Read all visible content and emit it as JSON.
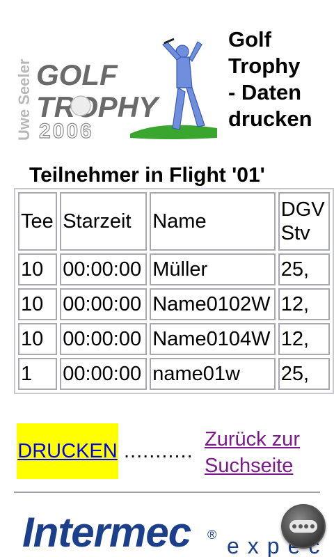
{
  "logo": {
    "author": "Uwe Seeler",
    "word1": "GOLF",
    "word2": "TROPHY",
    "year": "2006"
  },
  "page_title_lines": [
    "Golf",
    "Trophy",
    "- Daten",
    "drucken"
  ],
  "flight_heading": "Teilnehmer in Flight '01'",
  "table": {
    "headers": [
      "Tee",
      "Starzeit",
      "Name",
      "DGV",
      "Stv"
    ],
    "rows": [
      [
        "10",
        "00:00:00",
        "Müller",
        "25,"
      ],
      [
        "10",
        "00:00:00",
        "Name0102W",
        "12,"
      ],
      [
        "10",
        "00:00:00",
        "Name0104W",
        "12,"
      ],
      [
        "1",
        "00:00:00",
        "name01w",
        "25,"
      ]
    ]
  },
  "actions": {
    "print_label": "DRUCKEN",
    "separator": "...........",
    "back_link": "Zurück zur Suchseite"
  },
  "footer": {
    "brand": "Intermec",
    "trademark": "®",
    "suffix": "expec"
  },
  "colors": {
    "print_button_bg": "#ffff00",
    "link": "#0000ee",
    "visited_link": "#7b1a8b",
    "brand_blue": "#1c3f8c"
  }
}
